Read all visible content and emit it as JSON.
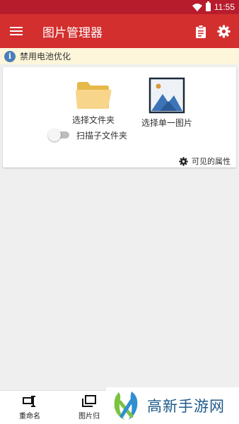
{
  "status_bar": {
    "time": "11:55",
    "icons": [
      "wifi-icon",
      "battery-icon"
    ]
  },
  "app_bar": {
    "title": "图片管理器",
    "icons": [
      "menu-icon",
      "clipboard-icon",
      "settings-gear-icon"
    ],
    "color": "#d32f2f"
  },
  "notice": {
    "text": "禁用电池优化",
    "icon": "info-icon"
  },
  "card": {
    "select_folder_label": "选择文件夹",
    "select_image_label": "选择单一图片",
    "scan_subfolders_label": "扫描子文件夹",
    "scan_subfolders_enabled": false,
    "visible_properties_label": "可见的属性"
  },
  "bottom_nav": {
    "items": [
      {
        "label": "重命名",
        "icon": "rename-icon"
      },
      {
        "label": "图片归",
        "icon": "archive-icon"
      }
    ]
  },
  "watermark": {
    "text": "高新手游网"
  }
}
